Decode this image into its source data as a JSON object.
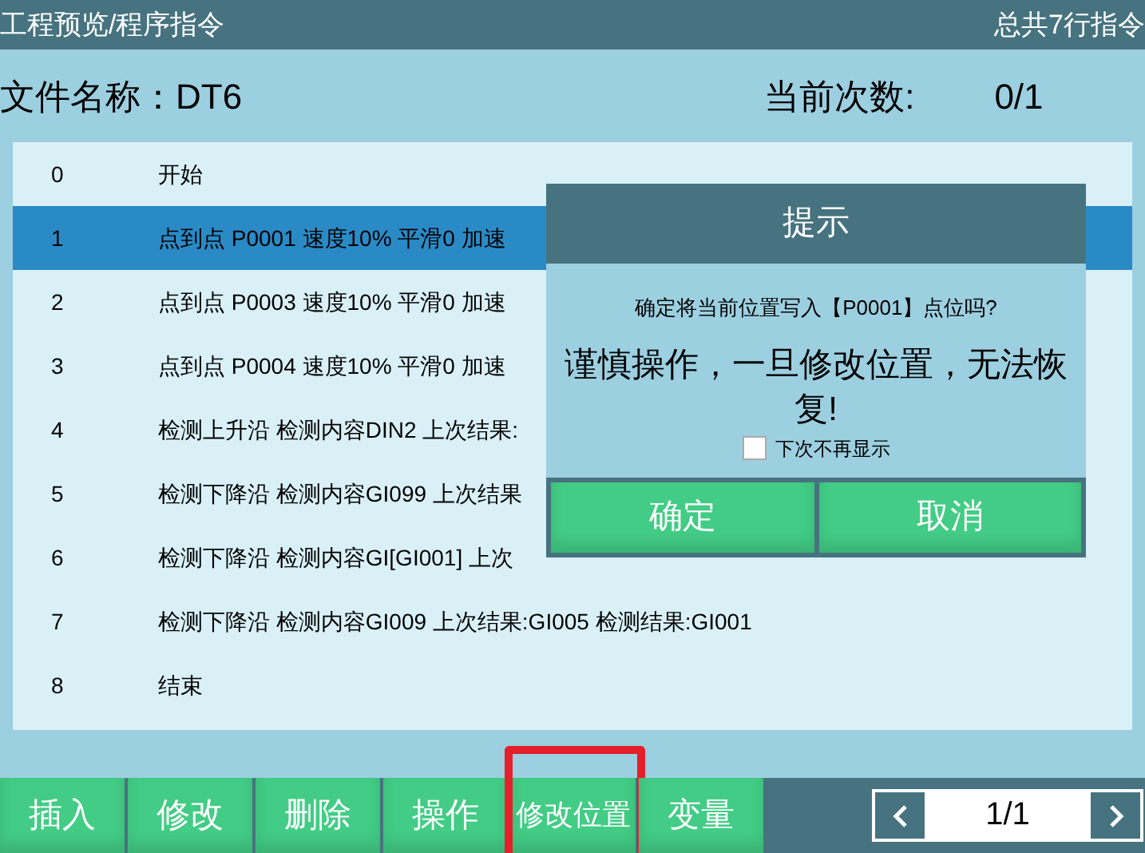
{
  "header": {
    "title": "工程预览/程序指令",
    "total": "总共7行指令"
  },
  "file": {
    "label": "文件名称：",
    "name": "DT6",
    "count_label": "当前次数:",
    "count": "0/1"
  },
  "rows": [
    {
      "index": "0",
      "text": "开始",
      "selected": false
    },
    {
      "index": "1",
      "text": "点到点 P0001 速度10%  平滑0 加速",
      "selected": true
    },
    {
      "index": "2",
      "text": "点到点 P0003 速度10%  平滑0 加速",
      "selected": false
    },
    {
      "index": "3",
      "text": "点到点 P0004 速度10%  平滑0 加速",
      "selected": false
    },
    {
      "index": "4",
      "text": "检测上升沿 检测内容DIN2 上次结果:",
      "selected": false
    },
    {
      "index": "5",
      "text": "检测下降沿 检测内容GI099 上次结果",
      "selected": false
    },
    {
      "index": "6",
      "text": "检测下降沿 检测内容GI[GI001] 上次",
      "selected": false
    },
    {
      "index": "7",
      "text": "检测下降沿 检测内容GI009 上次结果:GI005 检测结果:GI001",
      "selected": false
    },
    {
      "index": "8",
      "text": "结束",
      "selected": false
    }
  ],
  "dialog": {
    "title": "提示",
    "question": "确定将当前位置写入【P0001】点位吗?",
    "warning": "谨慎操作，一旦修改位置，无法恢复!",
    "checkbox": {
      "label": "下次不再显示",
      "checked": false
    },
    "buttons": [
      "确定",
      "取消"
    ]
  },
  "toolbar": [
    {
      "label": "插入",
      "highlighted": false
    },
    {
      "label": "修改",
      "highlighted": false
    },
    {
      "label": "删除",
      "highlighted": false
    },
    {
      "label": "操作",
      "highlighted": false
    },
    {
      "label": "修改位置",
      "highlighted": true
    },
    {
      "label": "变量",
      "highlighted": false
    }
  ],
  "pager": {
    "page": "1/1"
  }
}
